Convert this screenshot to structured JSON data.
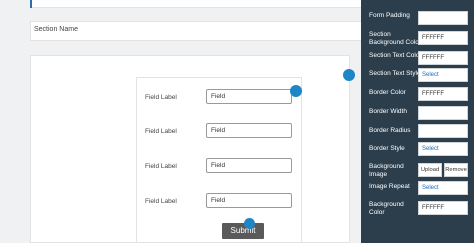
{
  "section": {
    "name": "Section Name"
  },
  "form": {
    "fields": [
      {
        "label": "Field Label",
        "value": "Field"
      },
      {
        "label": "Field Label",
        "value": "Field"
      },
      {
        "label": "Field Label",
        "value": "Field"
      },
      {
        "label": "Field Label",
        "value": "Field"
      }
    ],
    "submit_label": "Submit"
  },
  "panel": {
    "form_padding": {
      "label": "Form Padding",
      "value": ""
    },
    "section_bg_color": {
      "label_line1": "Section",
      "label_line2": "Background Color",
      "value": "FFFFFF"
    },
    "section_text_color": {
      "label": "Section Text Color",
      "value": "FFFFFF"
    },
    "section_text_style": {
      "label": "Section Text Style",
      "value": "Select"
    },
    "border_color": {
      "label": "Border Color",
      "value": "FFFFFF"
    },
    "border_width": {
      "label": "Border Width",
      "value": ""
    },
    "border_radius": {
      "label": "Border Radius",
      "value": ""
    },
    "border_style": {
      "label": "Border Style",
      "value": "Select"
    },
    "background_image": {
      "label_line1": "Background",
      "label_line2": "Image",
      "upload_label": "Upload",
      "remove_label": "Remove"
    },
    "image_repeat": {
      "label": "Image Repeat",
      "value": "Select"
    },
    "background_color": {
      "label_line1": "Background",
      "label_line2": "Color",
      "value": "FFFFFF"
    }
  },
  "colors": {
    "panel_bg": "#2c3e4c",
    "accent_dot": "#1e86c7",
    "submit_bg": "#5a5a5a"
  }
}
